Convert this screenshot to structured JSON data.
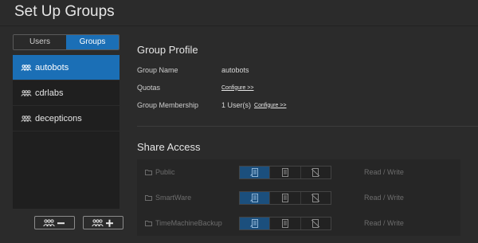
{
  "page": {
    "title": "Set Up Groups"
  },
  "left": {
    "tabs": [
      {
        "label": "Users"
      },
      {
        "label": "Groups"
      }
    ],
    "groups": [
      {
        "name": "autobots"
      },
      {
        "name": "cdrlabs"
      },
      {
        "name": "decepticons"
      }
    ]
  },
  "profile": {
    "title": "Group Profile",
    "name_label": "Group Name",
    "name_value": "autobots",
    "quotas_label": "Quotas",
    "quotas_link": "Configure >>",
    "membership_label": "Group Membership",
    "membership_value": "1 User(s)",
    "membership_link": "Configure >>"
  },
  "share": {
    "title": "Share Access",
    "rows": [
      {
        "name": "Public",
        "access": "Read / Write"
      },
      {
        "name": "SmartWare",
        "access": "Read / Write"
      },
      {
        "name": "TimeMachineBackup",
        "access": "Read / Write"
      }
    ]
  },
  "colors": {
    "accent": "#1b6fb6",
    "background": "#2b2b2b"
  },
  "icons": {
    "group": "group-icon",
    "remove_group": "remove-group-icon",
    "add_group": "add-group-icon",
    "folder": "folder-icon",
    "read_write": "read-write-icon",
    "read_only": "read-only-icon",
    "deny": "deny-access-icon"
  }
}
